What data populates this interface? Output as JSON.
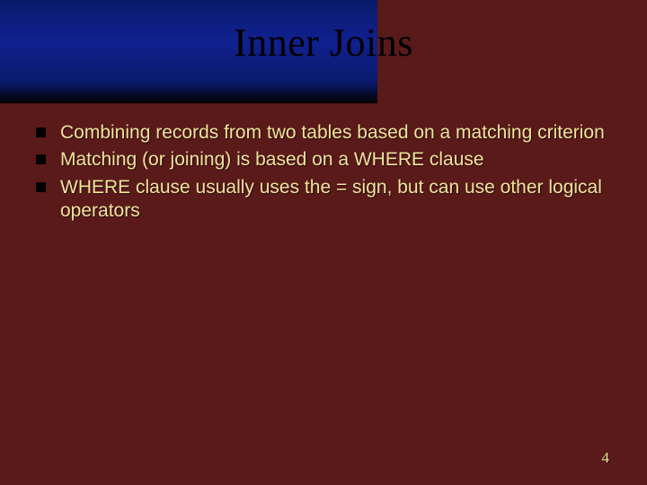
{
  "slide": {
    "title": "Inner Joins",
    "bullets": [
      "Combining records from two tables based on a matching criterion",
      "Matching (or joining) is based on a WHERE clause",
      "WHERE clause usually uses the = sign, but can use other logical operators"
    ],
    "page_number": "4"
  }
}
